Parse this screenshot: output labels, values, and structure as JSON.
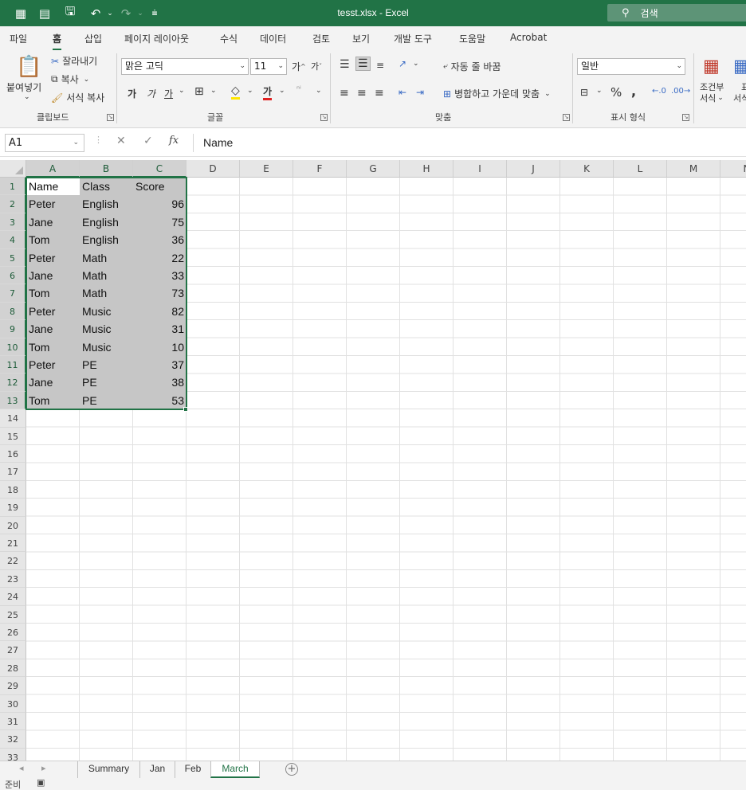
{
  "titlebar": {
    "title": "tesst.xlsx  -  Excel",
    "search_placeholder": "검색",
    "accent_color": "#217346"
  },
  "menu": {
    "tabs": [
      {
        "label": "파일"
      },
      {
        "label": "홈",
        "active": true
      },
      {
        "label": "삽입"
      },
      {
        "label": "페이지 레이아웃"
      },
      {
        "label": "수식"
      },
      {
        "label": "데이터"
      },
      {
        "label": "검토"
      },
      {
        "label": "보기"
      },
      {
        "label": "개발 도구"
      },
      {
        "label": "도움말"
      },
      {
        "label": "Acrobat"
      }
    ]
  },
  "ribbon": {
    "clipboard": {
      "paste": "붙여넣기",
      "cut": "잘라내기",
      "copy": "복사",
      "format_painter": "서식 복사",
      "group_label": "클립보드"
    },
    "font": {
      "font_name": "맑은 고딕",
      "font_size": "11",
      "grow": "가",
      "shrink": "가",
      "bold": "가",
      "italic": "가",
      "underline": "가",
      "font_color_label": "가",
      "group_label": "글꼴"
    },
    "alignment": {
      "wrap_text": "자동 줄 바꿈",
      "merge_center": "병합하고 가운데 맞춤",
      "group_label": "맞춤"
    },
    "number": {
      "format": "일반",
      "percent": "%",
      "comma": ",",
      "group_label": "표시 형식"
    },
    "styles": {
      "conditional_format": "조건부",
      "conditional_format_2": "서식",
      "format_as": "표",
      "format_as_2": "서식"
    }
  },
  "formula_bar": {
    "name_box": "A1",
    "fx": "fx",
    "value": "Name"
  },
  "grid": {
    "columns": [
      "A",
      "B",
      "C",
      "D",
      "E",
      "F",
      "G",
      "H",
      "I",
      "J",
      "K",
      "L",
      "M",
      "N"
    ],
    "rows": [
      "1",
      "2",
      "3",
      "4",
      "5",
      "6",
      "7",
      "8",
      "9",
      "10",
      "11",
      "12",
      "13",
      "14",
      "15",
      "16",
      "17",
      "18",
      "19",
      "20",
      "21",
      "22",
      "23",
      "24",
      "25",
      "26",
      "27",
      "28",
      "29",
      "30",
      "31",
      "32",
      "33"
    ],
    "data": [
      [
        "Name",
        "Class",
        "Score"
      ],
      [
        "Peter",
        "English",
        "96"
      ],
      [
        "Jane",
        "English",
        "75"
      ],
      [
        "Tom",
        "English",
        "36"
      ],
      [
        "Peter",
        "Math",
        "22"
      ],
      [
        "Jane",
        "Math",
        "33"
      ],
      [
        "Tom",
        "Math",
        "73"
      ],
      [
        "Peter",
        "Music",
        "82"
      ],
      [
        "Jane",
        "Music",
        "31"
      ],
      [
        "Tom",
        "Music",
        "10"
      ],
      [
        "Peter",
        "PE",
        "37"
      ],
      [
        "Jane",
        "PE",
        "38"
      ],
      [
        "Tom",
        "PE",
        "53"
      ]
    ]
  },
  "sheets": {
    "tabs": [
      {
        "label": "Summary"
      },
      {
        "label": "Jan"
      },
      {
        "label": "Feb"
      },
      {
        "label": "March",
        "active": true
      }
    ],
    "add": "+"
  },
  "status": {
    "text": "준비"
  }
}
